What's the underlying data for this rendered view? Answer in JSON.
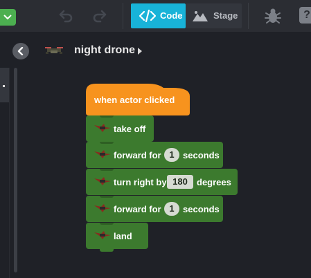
{
  "toolbar": {
    "code_label": "Code",
    "stage_label": "Stage",
    "help_label": "?",
    "active_tab": "Code",
    "accent_color": "#18b3d8",
    "green_button_color": "#4caf50"
  },
  "actor": {
    "name": "night drone"
  },
  "script": {
    "event_label": "when actor clicked",
    "event_color": "#f7931e",
    "block_color": "#3c7a2e",
    "blocks": [
      {
        "label": "take off"
      },
      {
        "label_before": "forward for",
        "value": "1",
        "label_after": "seconds"
      },
      {
        "label_before": "turn right by",
        "value": "180",
        "label_after": "degrees"
      },
      {
        "label_before": "forward for",
        "value": "1",
        "label_after": "seconds"
      },
      {
        "label": "land"
      }
    ]
  },
  "icons": {
    "menu": "chevron-down-icon",
    "undo": "undo-icon",
    "redo": "redo-icon",
    "code": "code-icon",
    "stage": "mountain-icon",
    "debug": "bug-icon",
    "help": "help-icon",
    "back": "chevron-left-icon",
    "actor": "drone-icon",
    "caret": "caret-right-icon"
  }
}
